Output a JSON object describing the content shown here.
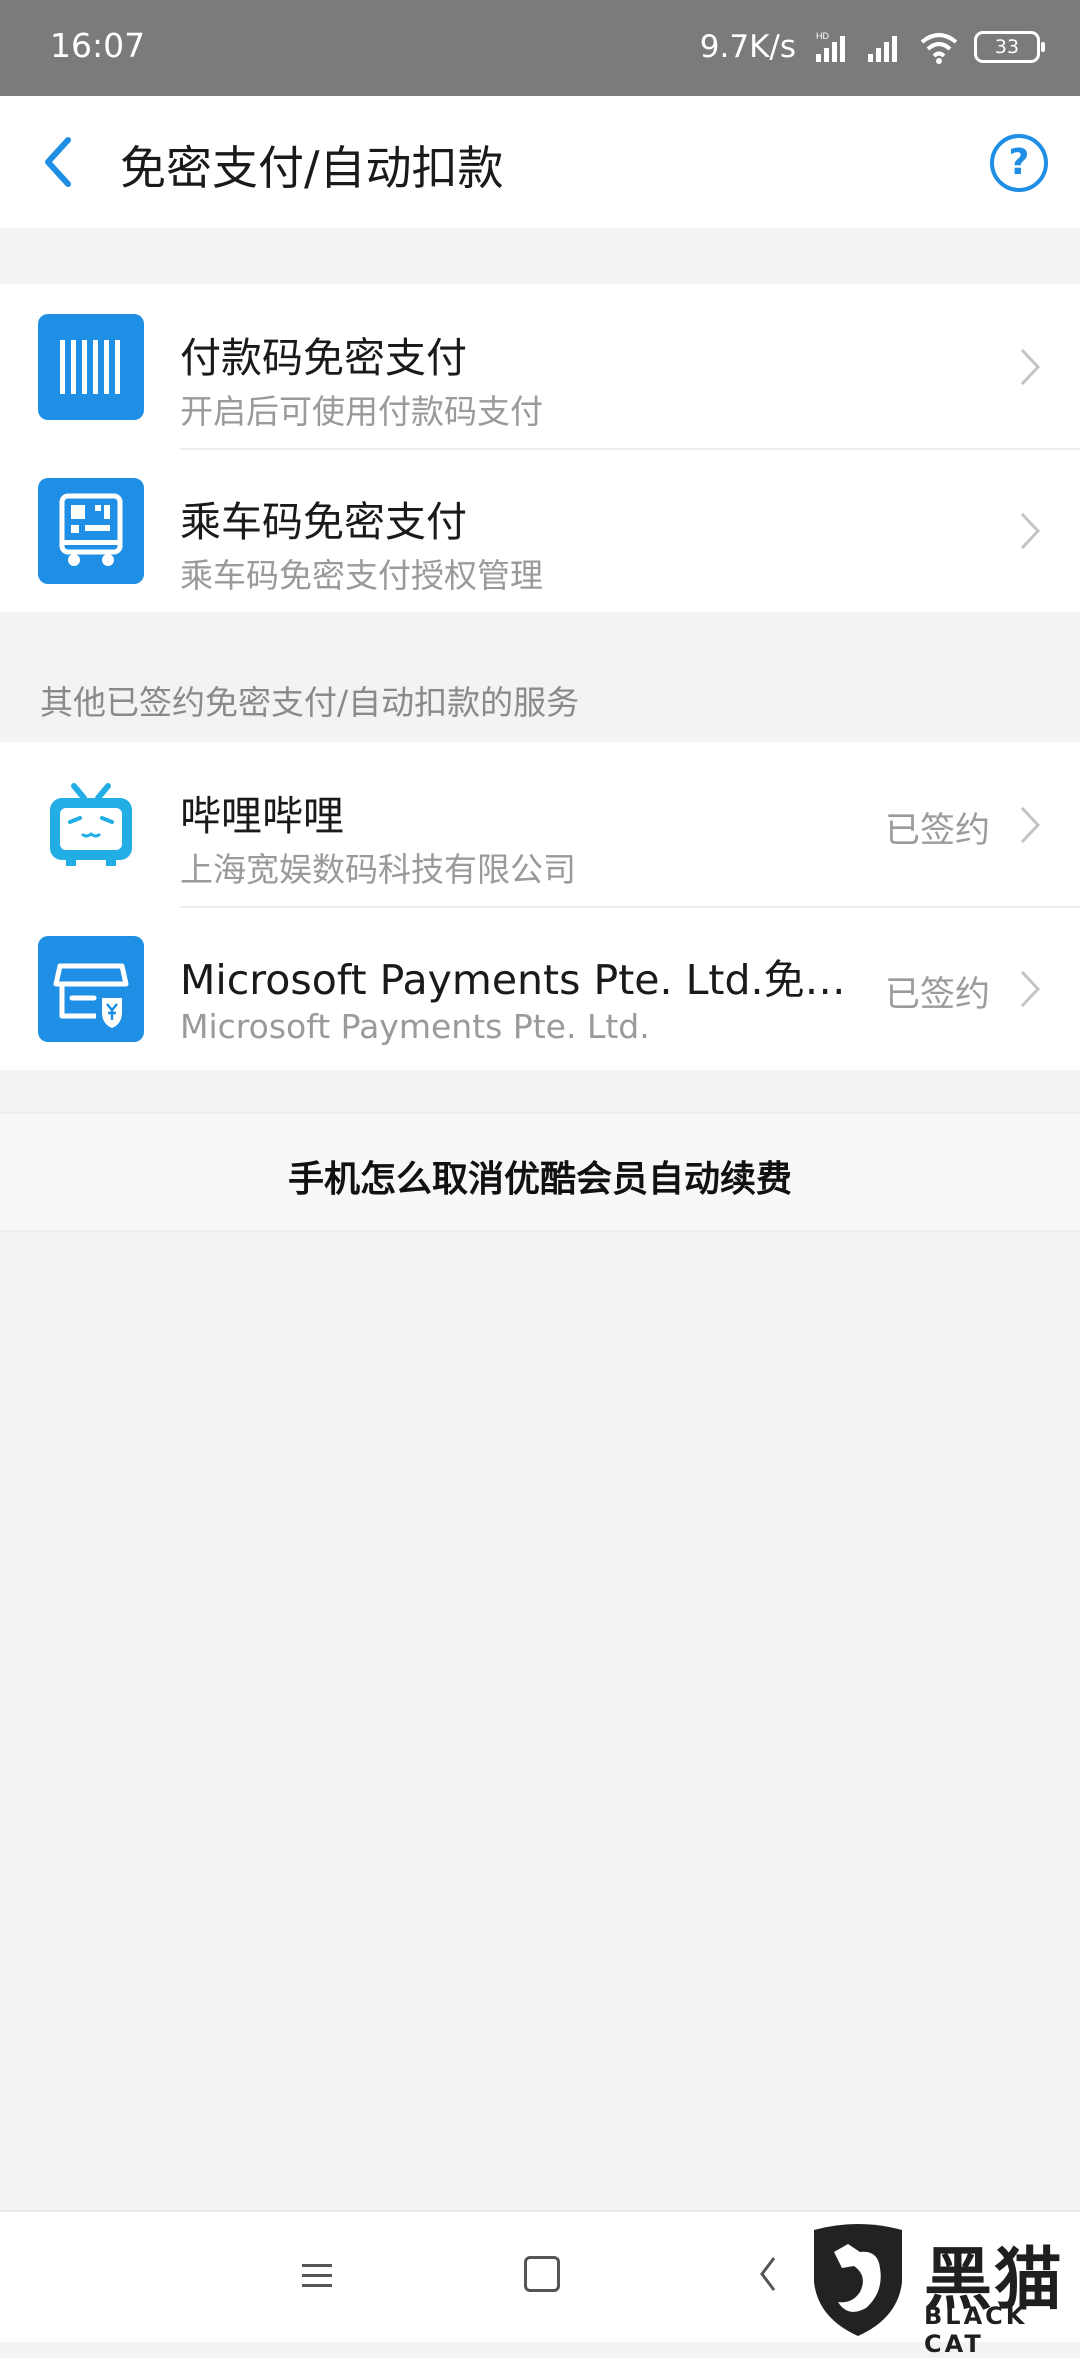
{
  "status_bar": {
    "time": "16:07",
    "network_speed": "9.7K/s",
    "network_badge": "HD",
    "battery": "33"
  },
  "header": {
    "title": "免密支付/自动扣款",
    "help_symbol": "?"
  },
  "primary_services": [
    {
      "title": "付款码免密支付",
      "subtitle": "开启后可使用付款码支付",
      "icon": "barcode-icon"
    },
    {
      "title": "乘车码免密支付",
      "subtitle": "乘车码免密支付授权管理",
      "icon": "bus-qr-icon"
    }
  ],
  "signed_section_label": "其他已签约免密支付/自动扣款的服务",
  "signed_services": [
    {
      "title": "哔哩哔哩",
      "subtitle": "上海宽娱数码科技有限公司",
      "status": "已签约",
      "icon": "bilibili-tv-icon"
    },
    {
      "title": "Microsoft Payments Pte. Ltd.免…",
      "subtitle": "Microsoft Payments Pte. Ltd.",
      "status": "已签约",
      "icon": "store-yuan-icon"
    }
  ],
  "ad_banner": "手机怎么取消优酷会员自动续费",
  "watermark": {
    "cn": "黑猫",
    "en": "BLACK CAT"
  },
  "colors": {
    "accent": "#1f8fe5",
    "bilibili": "#23ade5",
    "statusbar": "#7b7b7b"
  }
}
